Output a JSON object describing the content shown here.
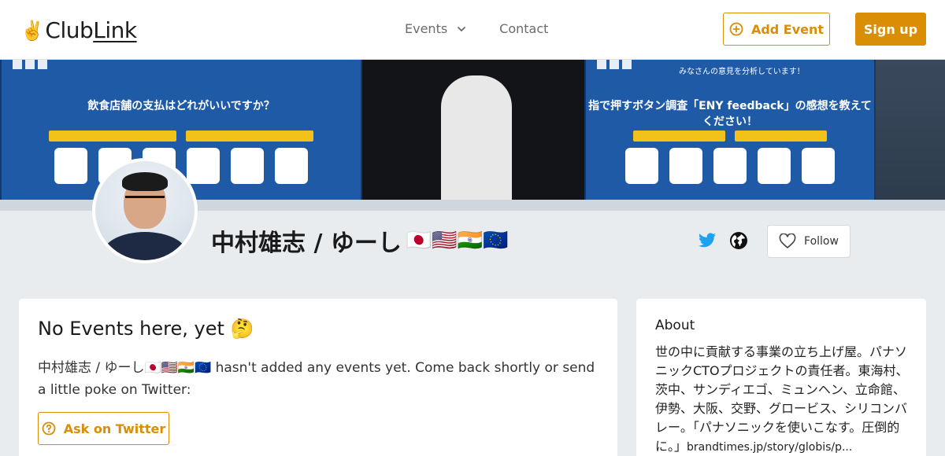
{
  "header": {
    "logo_emoji": "✌️",
    "logo_club": "Club",
    "logo_link": "Link",
    "nav": {
      "events": "Events",
      "contact": "Contact"
    },
    "add_event": "Add Event",
    "sign_up": "Sign up"
  },
  "profile": {
    "name": "中村雄志 / ゆーし",
    "flags": "🇯🇵🇺🇸🇮🇳🇪🇺",
    "follow": "Follow"
  },
  "events_card": {
    "title": "No Events here, yet 🤔",
    "message": "中村雄志 / ゆーし🇯🇵🇺🇸🇮🇳🇪🇺 hasn't added any events yet. Come back shortly or send a little poke on Twitter:",
    "ask_button": "Ask on Twitter"
  },
  "about_card": {
    "title": "About",
    "bio": "世の中に貢献する事業の立ち上げ屋。パナソニックCTOプロジェクトの責任者。東海村、茨中、サンディエゴ、ミュンヘン、立命館、伊勢、大阪、交野、グロービス、シリコンバレー。「パナソニックを使いこなす。圧倒的に。」",
    "bio_url": "brandtimes.jp/story/globis/p..."
  },
  "banner": {
    "left_heading": "飲食店舗の支払はどれがいいですか？",
    "right_heading": "指で押すボタン調査「ENY feedback」の感想を教えてください！",
    "right_top": "みなさんの意見を分析しています！"
  },
  "colors": {
    "accent": "#d98e06",
    "twitter": "#1da1f2"
  },
  "icons": [
    "chevron-down-icon",
    "plus-circle-icon",
    "twitter-icon",
    "globe-icon",
    "heart-icon",
    "help-circle-icon"
  ]
}
